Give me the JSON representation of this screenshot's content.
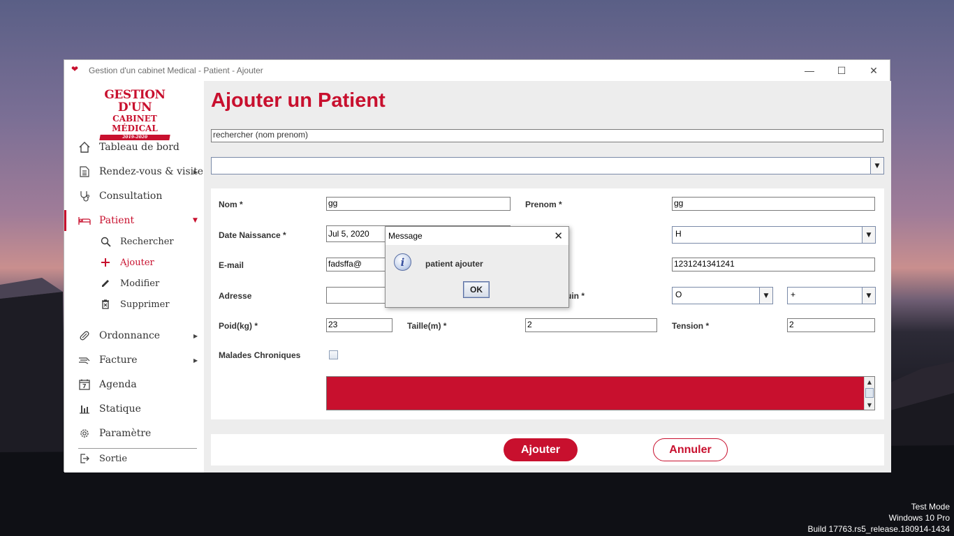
{
  "window": {
    "title": "Gestion d'un cabinet Medical - Patient - Ajouter",
    "controls": {
      "minimize": "—",
      "maximize": "☐",
      "close": "✕"
    }
  },
  "logo": {
    "line1": "GESTION D'UN",
    "line2": "CABINET MÉDICAL",
    "line3": "2019-2020"
  },
  "sidebar": {
    "items": [
      {
        "label": "Tableau de bord",
        "icon": "home-icon"
      },
      {
        "label": "Rendez-vous & visite",
        "icon": "document-icon",
        "arrow": "▶"
      },
      {
        "label": "Consultation",
        "icon": "stethoscope-icon"
      },
      {
        "label": "Patient",
        "icon": "bed-icon",
        "arrow": "▼",
        "active": true
      },
      {
        "label": "Ordonnance",
        "icon": "pill-icon",
        "arrow": "▶"
      },
      {
        "label": "Facture",
        "icon": "cash-icon",
        "arrow": "▶"
      },
      {
        "label": "Agenda",
        "icon": "calendar-icon"
      },
      {
        "label": "Statique",
        "icon": "bar-chart-icon"
      },
      {
        "label": "Paramètre",
        "icon": "gear-icon"
      },
      {
        "label": "Sortie",
        "icon": "logout-icon"
      }
    ],
    "subitems": [
      {
        "label": "Rechercher",
        "icon": "search-icon"
      },
      {
        "label": "Ajouter",
        "icon": "plus-icon",
        "active": true
      },
      {
        "label": "Modifier",
        "icon": "pencil-icon"
      },
      {
        "label": "Supprimer",
        "icon": "trash-icon"
      }
    ]
  },
  "main": {
    "title": "Ajouter un Patient",
    "search": {
      "value": "rechercher (nom prenom)"
    },
    "results_combo": {
      "value": ""
    }
  },
  "form": {
    "nom": {
      "label": "Nom *",
      "value": "gg"
    },
    "prenom": {
      "label": "Prenom *",
      "value": "gg"
    },
    "date_naissance": {
      "label": "Date Naissance *",
      "value": "Jul 5, 2020"
    },
    "sexe": {
      "value": "H"
    },
    "email": {
      "label": "E-mail",
      "value": "fadsffa@"
    },
    "telephone": {
      "value": "1231241341241"
    },
    "adresse": {
      "label": "Adresse",
      "value": ""
    },
    "groupe_sanguin": {
      "label_fragment": "uin *",
      "group": "O",
      "rhesus": "+"
    },
    "poid": {
      "label": "Poid(kg) *",
      "value": "23"
    },
    "taille": {
      "label": "Taille(m) *",
      "value": "2"
    },
    "tension": {
      "label": "Tension *",
      "value": "2"
    },
    "malades": {
      "label": "Malades Chroniques",
      "checked": false
    },
    "accent": "#c8102e"
  },
  "actions": {
    "ajouter": "Ajouter",
    "annuler": "Annuler"
  },
  "dialog": {
    "title": "Message",
    "message": "patient ajouter",
    "ok": "OK",
    "icon": "info-icon"
  },
  "watermark": {
    "line1": "Test Mode",
    "line2": "Windows 10 Pro",
    "line3": "Build 17763.rs5_release.180914-1434"
  }
}
